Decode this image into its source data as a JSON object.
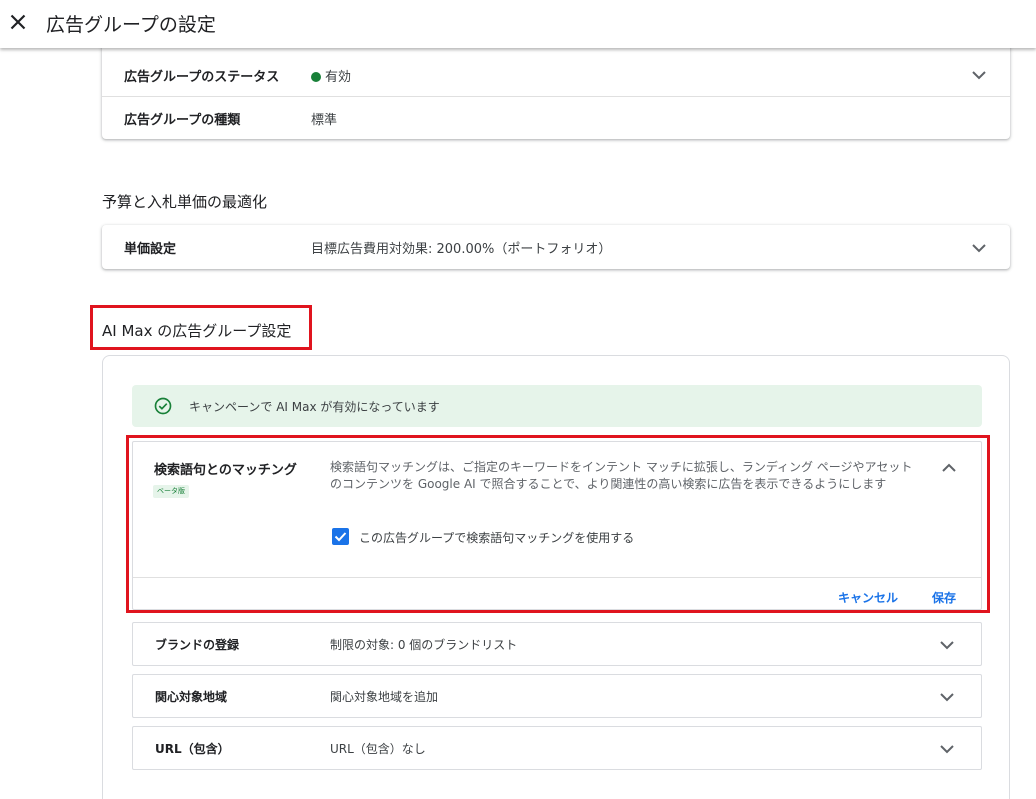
{
  "header": {
    "title": "広告グループの設定",
    "close_icon": "close-icon"
  },
  "ad_group": {
    "status_label": "広告グループのステータス",
    "status_value": "有効",
    "status_color": "#188038",
    "type_label": "広告グループの種類",
    "type_value": "標準"
  },
  "budget_section": {
    "title": "予算と入札単価の最適化",
    "bid_label": "単価設定",
    "bid_value": "目標広告費用対効果: 200.00%（ポートフォリオ）"
  },
  "ai_max": {
    "title": "AI Max の広告グループ設定",
    "notice": "キャンペーンで AI Max が有効になっています",
    "matching": {
      "title": "検索語句とのマッチング",
      "beta_badge": "ベータ版",
      "description": "検索語句マッチングは、ご指定のキーワードをインテント マッチに拡張し、ランディング ページやアセットのコンテンツを Google AI で照合することで、より関連性の高い検索に広告を表示できるようにします",
      "checkbox_label": "この広告グループで検索語句マッチングを使用する",
      "checkbox_checked": true,
      "cancel_label": "キャンセル",
      "save_label": "保存"
    },
    "rows": [
      {
        "label": "ブランドの登録",
        "value": "制限の対象: 0 個のブランドリスト"
      },
      {
        "label": "関心対象地域",
        "value": "関心対象地域を追加"
      },
      {
        "label": "URL（包含）",
        "value": "URL（包含）なし"
      }
    ]
  },
  "colors": {
    "accent": "#1a73e8",
    "success_bg": "#e6f4ea",
    "highlight_border": "#e0141e"
  }
}
